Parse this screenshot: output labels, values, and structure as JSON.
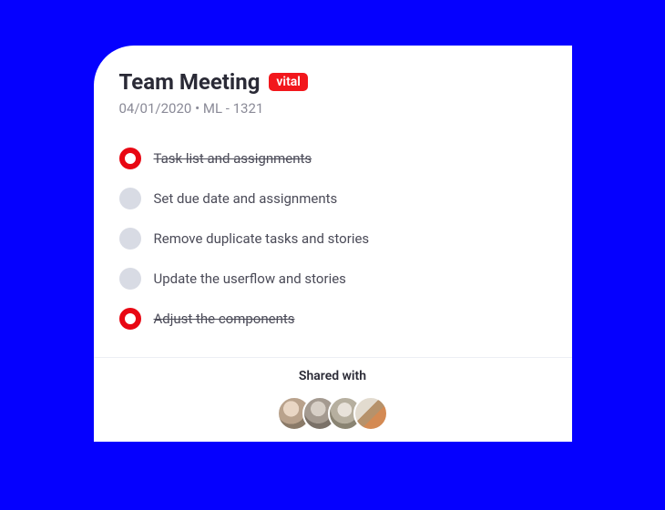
{
  "card": {
    "title": "Team Meeting",
    "tag": "vital",
    "date": "04/01/2020",
    "separator": "•",
    "code": "ML - 1321"
  },
  "tasks": [
    {
      "label": "Task list and assignments",
      "done": true
    },
    {
      "label": "Set due date and assignments",
      "done": false
    },
    {
      "label": "Remove duplicate tasks and stories",
      "done": false
    },
    {
      "label": "Update the userflow and stories",
      "done": false
    },
    {
      "label": "Adjust the components",
      "done": true
    }
  ],
  "shared": {
    "label": "Shared with",
    "avatars": [
      "user-1",
      "user-2",
      "user-3",
      "user-4"
    ]
  },
  "colors": {
    "accent": "#f2171c",
    "bg": "#0500ff"
  }
}
